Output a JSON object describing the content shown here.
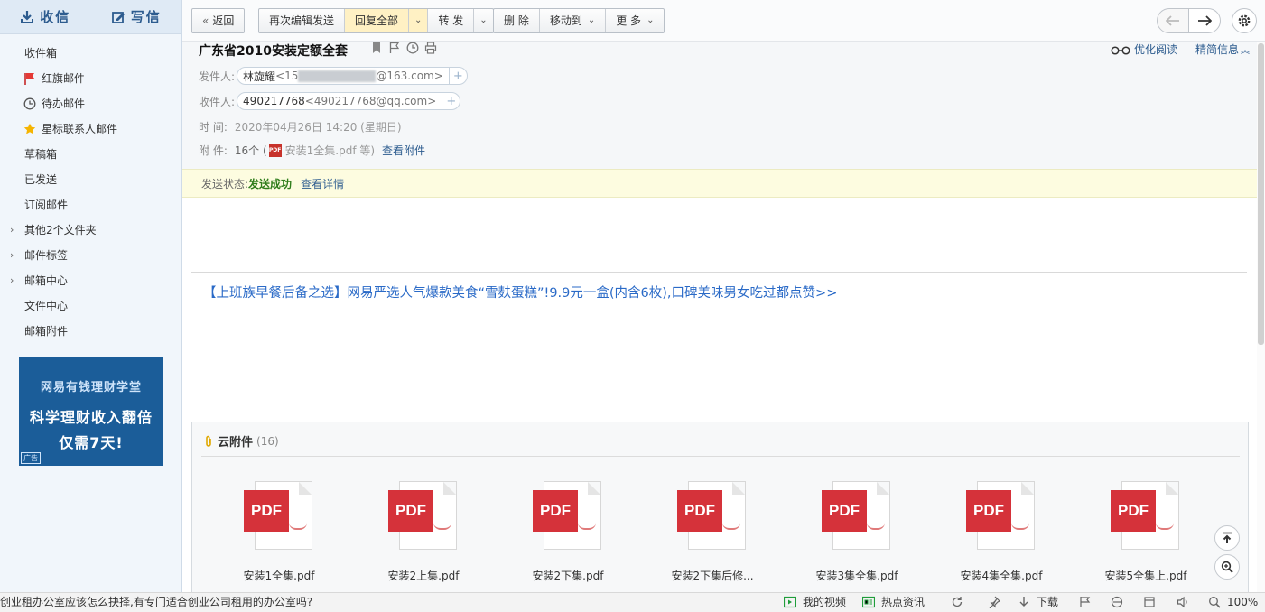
{
  "sidebar": {
    "receive_label": "收信",
    "compose_label": "写信",
    "folders": [
      {
        "label": "收件箱",
        "icon": ""
      },
      {
        "label": "红旗邮件",
        "icon": "red-flag-icon"
      },
      {
        "label": "待办邮件",
        "icon": "clock-icon"
      },
      {
        "label": "星标联系人邮件",
        "icon": "star-icon"
      },
      {
        "label": "草稿箱",
        "icon": ""
      },
      {
        "label": "已发送",
        "icon": ""
      },
      {
        "label": "订阅邮件",
        "icon": ""
      },
      {
        "label": "其他2个文件夹",
        "icon": "",
        "expandable": true
      },
      {
        "label": "邮件标签",
        "icon": "",
        "expandable": true
      },
      {
        "label": "邮箱中心",
        "icon": "",
        "expandable": true
      },
      {
        "label": "文件中心",
        "icon": ""
      },
      {
        "label": "邮箱附件",
        "icon": ""
      }
    ],
    "ad": {
      "line1": "网易有钱理财学堂",
      "line2": "科学理财收入翻倍",
      "line3": "仅需7天!",
      "tag": "广告"
    }
  },
  "toolbar": {
    "back": "返回",
    "edit_resend": "再次编辑发送",
    "reply_all": "回复全部",
    "forward": "转 发",
    "delete": "删 除",
    "move_to": "移动到",
    "more": "更 多"
  },
  "mail": {
    "subject": "广东省2010安装定额全套",
    "optimize_read": "优化阅读",
    "precise_info": "精简信息",
    "from_label": "发件人:",
    "from_name": "林旋耀",
    "from_addr_prefix": "<15",
    "from_addr_suffix": "@163.com>",
    "to_label": "收件人:",
    "to_name": "490217768",
    "to_addr": "<490217768@qq.com>",
    "time_label": "时 间:",
    "time_value": "2020年04月26日 14:20 (星期日)",
    "attach_label": "附 件:",
    "attach_count": "16个 (",
    "attach_first": "安装1全集.pdf 等)",
    "view_attach": "查看附件",
    "send_status_label": "发送状态:",
    "send_status_value": "发送成功",
    "view_detail": "查看详情",
    "promo": "【上班族早餐后备之选】网易严选人气爆款美食“雪麸蛋糕”!9.9元一盒(内含6枚),口碑美味男女吃过都点赞>>"
  },
  "attachments": {
    "title": "云附件",
    "count": "(16)",
    "items": [
      {
        "name": "安装1全集.pdf"
      },
      {
        "name": "安装2上集.pdf"
      },
      {
        "name": "安装2下集.pdf"
      },
      {
        "name": "安装2下集后修..."
      },
      {
        "name": "安装3集全集.pdf"
      },
      {
        "name": "安装4集全集.pdf"
      },
      {
        "name": "安装5全集上.pdf"
      }
    ],
    "badge": "PDF"
  },
  "statusline": {
    "news": "创业租办公室应该怎么抉择,有专门适合创业公司租用的办公室吗?",
    "my_video": "我的视频",
    "hot_news": "热点资讯",
    "download": "下载",
    "zoom": "100%"
  },
  "colors": {
    "accent": "#2d5c8f",
    "success": "#2f7d1b",
    "promo": "#2a6ac7",
    "pdf_red": "#d5323a"
  }
}
